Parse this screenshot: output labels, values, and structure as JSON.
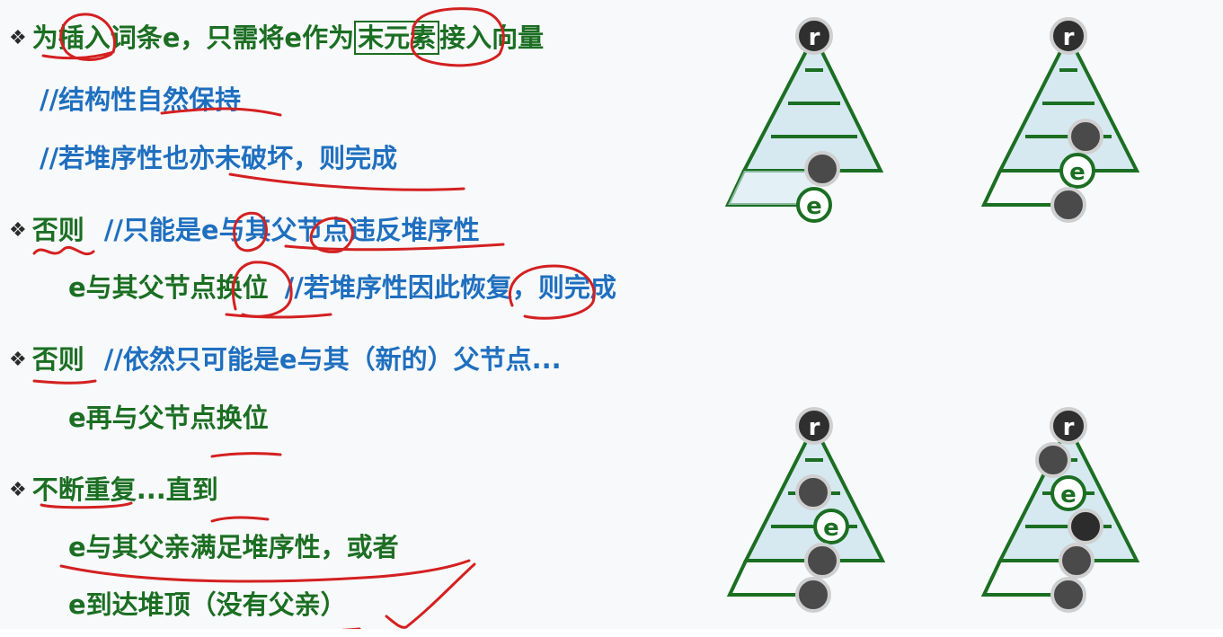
{
  "lines": {
    "l1_pre": "为插入词条e，只需将e作为",
    "l1_box": "末元素",
    "l1_post": "接入向量",
    "l2": "//结构性自然保持",
    "l3": "//若堆序性也亦未破坏，则完成",
    "l4a": "否则",
    "l4b": "//只能是e与其父节点违反堆序性",
    "l5a": "e与其父节点换位",
    "l5b": "//若堆序性因此恢复，则完成",
    "l6a": "否则",
    "l6b": "//依然只可能是e与其（新的）父节点...",
    "l7": "e再与父节点换位",
    "l8": "不断重复...直到",
    "l9": "e与其父亲满足堆序性，或者",
    "l10": "e到达堆顶（没有父亲）"
  },
  "bullet_icon": "diamond-bullet-icon",
  "diagram": {
    "root_label": "r",
    "node_label": "e"
  },
  "colors": {
    "green": "#1b6e22",
    "blue": "#1f6fbf",
    "tree_fill": "#d6e9f1",
    "node_gray": "#4a4a4a",
    "annotation_red": "#d42020"
  }
}
